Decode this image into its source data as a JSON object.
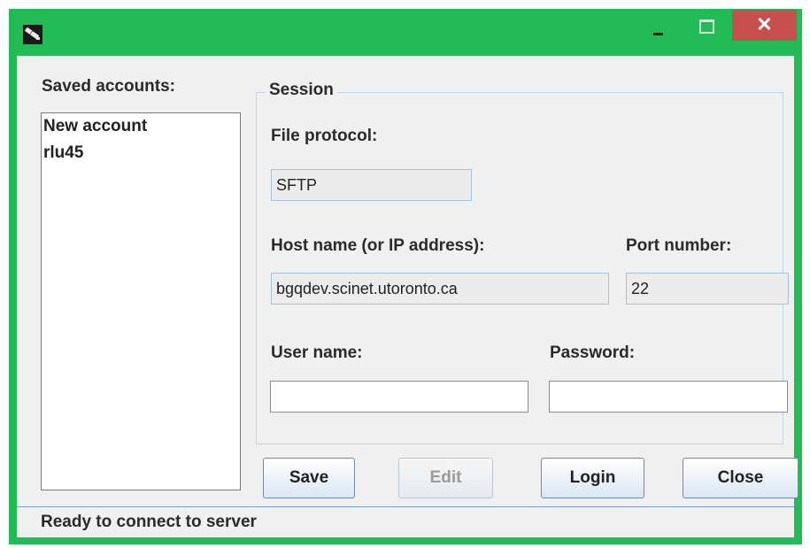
{
  "window": {
    "icon": "app-plug-icon",
    "controls": {
      "minimize": "minimize-icon",
      "maximize": "maximize-icon",
      "close": "✕"
    },
    "frame_color": "#22bb55",
    "close_color": "#c7504e"
  },
  "saved_accounts": {
    "label": "Saved accounts:",
    "items": [
      "New account",
      "rlu45"
    ]
  },
  "session": {
    "title": "Session",
    "file_protocol": {
      "label": "File protocol:",
      "value": "SFTP"
    },
    "host": {
      "label": "Host name (or IP address):",
      "value": "bgqdev.scinet.utoronto.ca"
    },
    "port": {
      "label": "Port number:",
      "value": "22"
    },
    "username": {
      "label": "User name:",
      "value": ""
    },
    "password": {
      "label": "Password:",
      "value": ""
    }
  },
  "buttons": {
    "save": "Save",
    "edit": "Edit",
    "login": "Login",
    "close": "Close"
  },
  "status": "Ready to connect to server"
}
